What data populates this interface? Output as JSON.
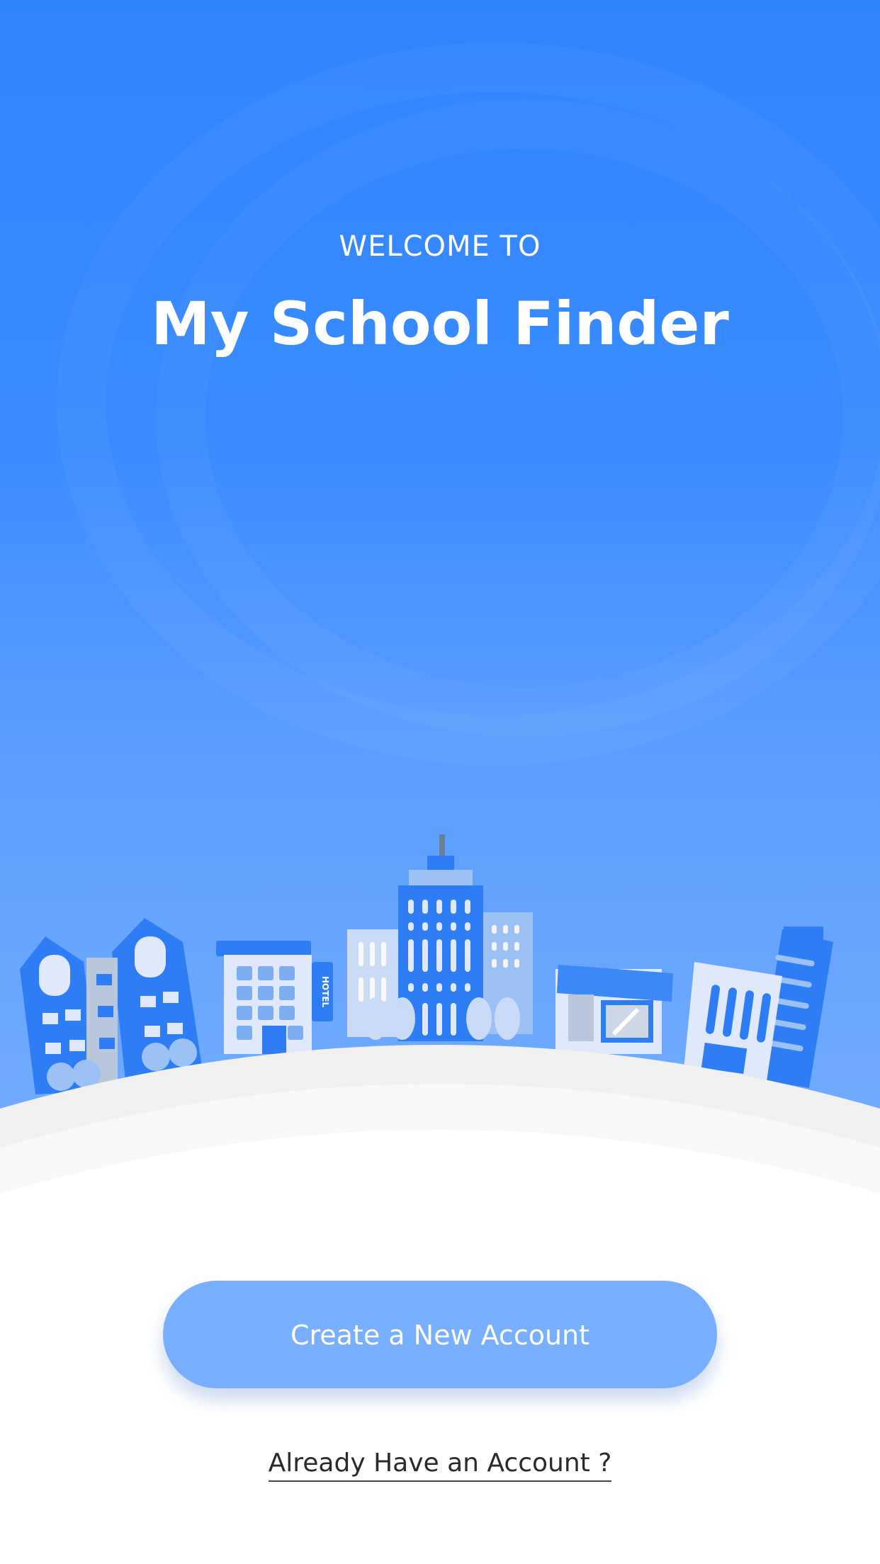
{
  "welcome_label": "WELCOME TO",
  "app_title": "My School Finder",
  "hotel_sign": "HOTEL",
  "create_account_label": "Create a New Account",
  "login_link_label": "Already Have an Account ?",
  "colors": {
    "primary_blue": "#2f84ff",
    "button_blue": "#78afff",
    "text_dark": "#2a2a2a",
    "white": "#ffffff"
  }
}
